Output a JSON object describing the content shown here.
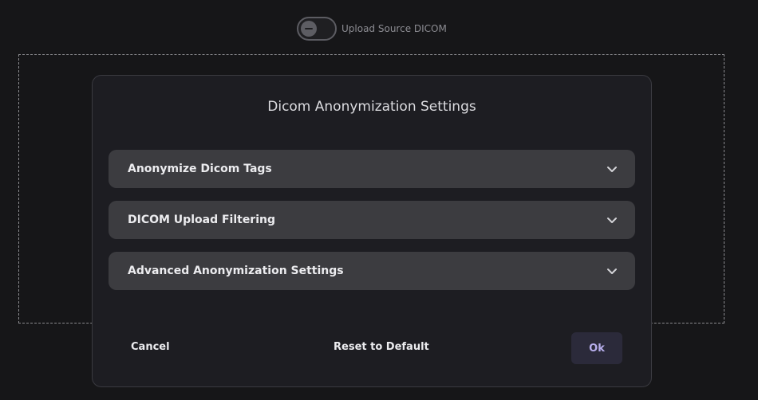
{
  "toggle": {
    "label": "Upload Source DICOM",
    "state": "off"
  },
  "modal": {
    "title": "Dicom Anonymization Settings",
    "sections": [
      {
        "label": "Anonymize Dicom Tags",
        "icon": "chevron-down-icon"
      },
      {
        "label": "DICOM Upload Filtering",
        "icon": "chevron-down-icon"
      },
      {
        "label": "Advanced Anonymization Settings",
        "icon": "chevron-down-icon"
      }
    ],
    "footer": {
      "cancel_label": "Cancel",
      "reset_label": "Reset to Default",
      "ok_label": "Ok"
    }
  },
  "colors": {
    "background": "#161618",
    "modal": "#1d1d22",
    "section": "#3c3c40",
    "ok_button": "#2b2a3a",
    "ok_text": "#b9b0ee"
  }
}
